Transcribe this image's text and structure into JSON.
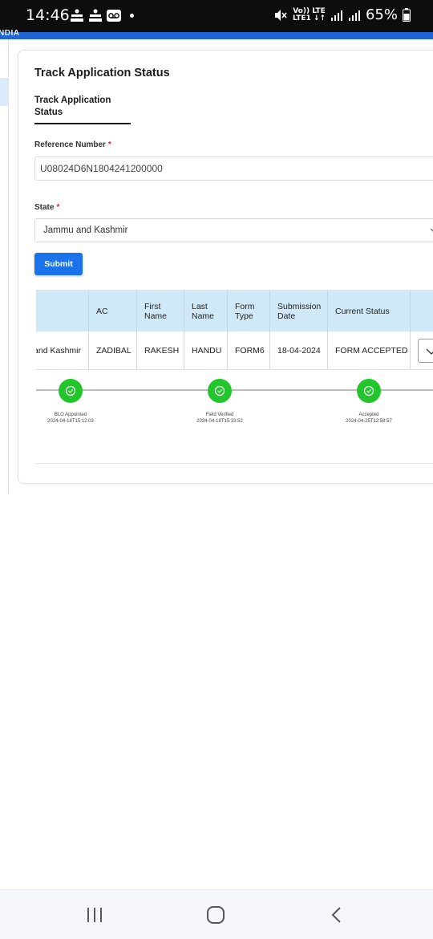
{
  "status_bar": {
    "time": "14:46",
    "network_top": "Vo)) LTE",
    "network_bottom": "LTE1 ↓↑",
    "battery": "65%"
  },
  "app_bar": {
    "text": "NDIA"
  },
  "page": {
    "title": "Track Application Status",
    "tab_label": "Track Application Status"
  },
  "form": {
    "reference_label": "Reference Number",
    "reference_value": "U08024D6N1804241200000",
    "state_label": "State",
    "state_value": "Jammu and Kashmir",
    "required_mark": "*",
    "submit_label": "Submit"
  },
  "table": {
    "headers": [
      "",
      "AC",
      "First Name",
      "Last Name",
      "Form Type",
      "Submission Date",
      "Current Status",
      ""
    ],
    "row": [
      "and Kashmir",
      "ZADIBAL",
      "RAKESH",
      "HANDU",
      "FORM6",
      "18-04-2024",
      "FORM ACCEPTED"
    ]
  },
  "timeline": [
    {
      "label": "BLO Appointed",
      "time": "2024-04-18T15:12:03"
    },
    {
      "label": "Field Verified",
      "time": "2024-04-18T15:33:52"
    },
    {
      "label": "Accepted",
      "time": "2024-04-25T12:58:57"
    }
  ],
  "colors": {
    "accent": "#1a73e8",
    "header_bg": "#cfe9f8",
    "success": "#22c52b"
  }
}
